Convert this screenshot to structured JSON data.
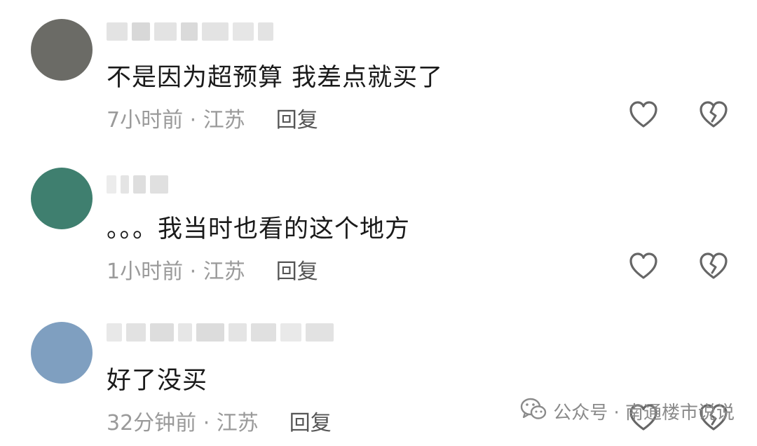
{
  "comments": [
    {
      "text": "不是因为超预算 我差点就买了",
      "time": "7小时前 · 江苏",
      "reply_label": "回复",
      "like_icon": "heart-outline-icon",
      "dislike_icon": "broken-heart-icon",
      "avatar_palette": [
        "#6b6b66",
        "#8a7c70",
        "#c9b9a8",
        "#e9e1d6",
        "#3d3a36",
        "#a39587",
        "#d8cdbf",
        "#51493f"
      ]
    },
    {
      "text": "。。。我当时也看的这个地方",
      "time": "1小时前 · 江苏",
      "reply_label": "回复",
      "like_icon": "heart-outline-icon",
      "dislike_icon": "broken-heart-icon",
      "avatar_palette": [
        "#3f7f6f",
        "#c0413c",
        "#e8d8b8",
        "#2d4a4a",
        "#8fb7a8",
        "#d9574f",
        "#6f5a3d",
        "#b8c9c0"
      ]
    },
    {
      "text": "好了没买",
      "time": "32分钟前 · 江苏",
      "reply_label": "回复",
      "like_icon": "heart-outline-icon",
      "dislike_icon": "broken-heart-icon",
      "avatar_palette": [
        "#7f9fc0",
        "#b8c7d8",
        "#7a4a2e",
        "#c2874d",
        "#4a2e20",
        "#a05a35",
        "#d6b38a",
        "#5c6f86"
      ]
    }
  ],
  "watermark": {
    "text": "公众号 · 南通楼市说说",
    "icon": "wechat-icon"
  },
  "colors": {
    "text": "#1a1a1a",
    "meta": "#9a9a9a",
    "reply": "#555555",
    "icon_stroke": "#666666"
  }
}
